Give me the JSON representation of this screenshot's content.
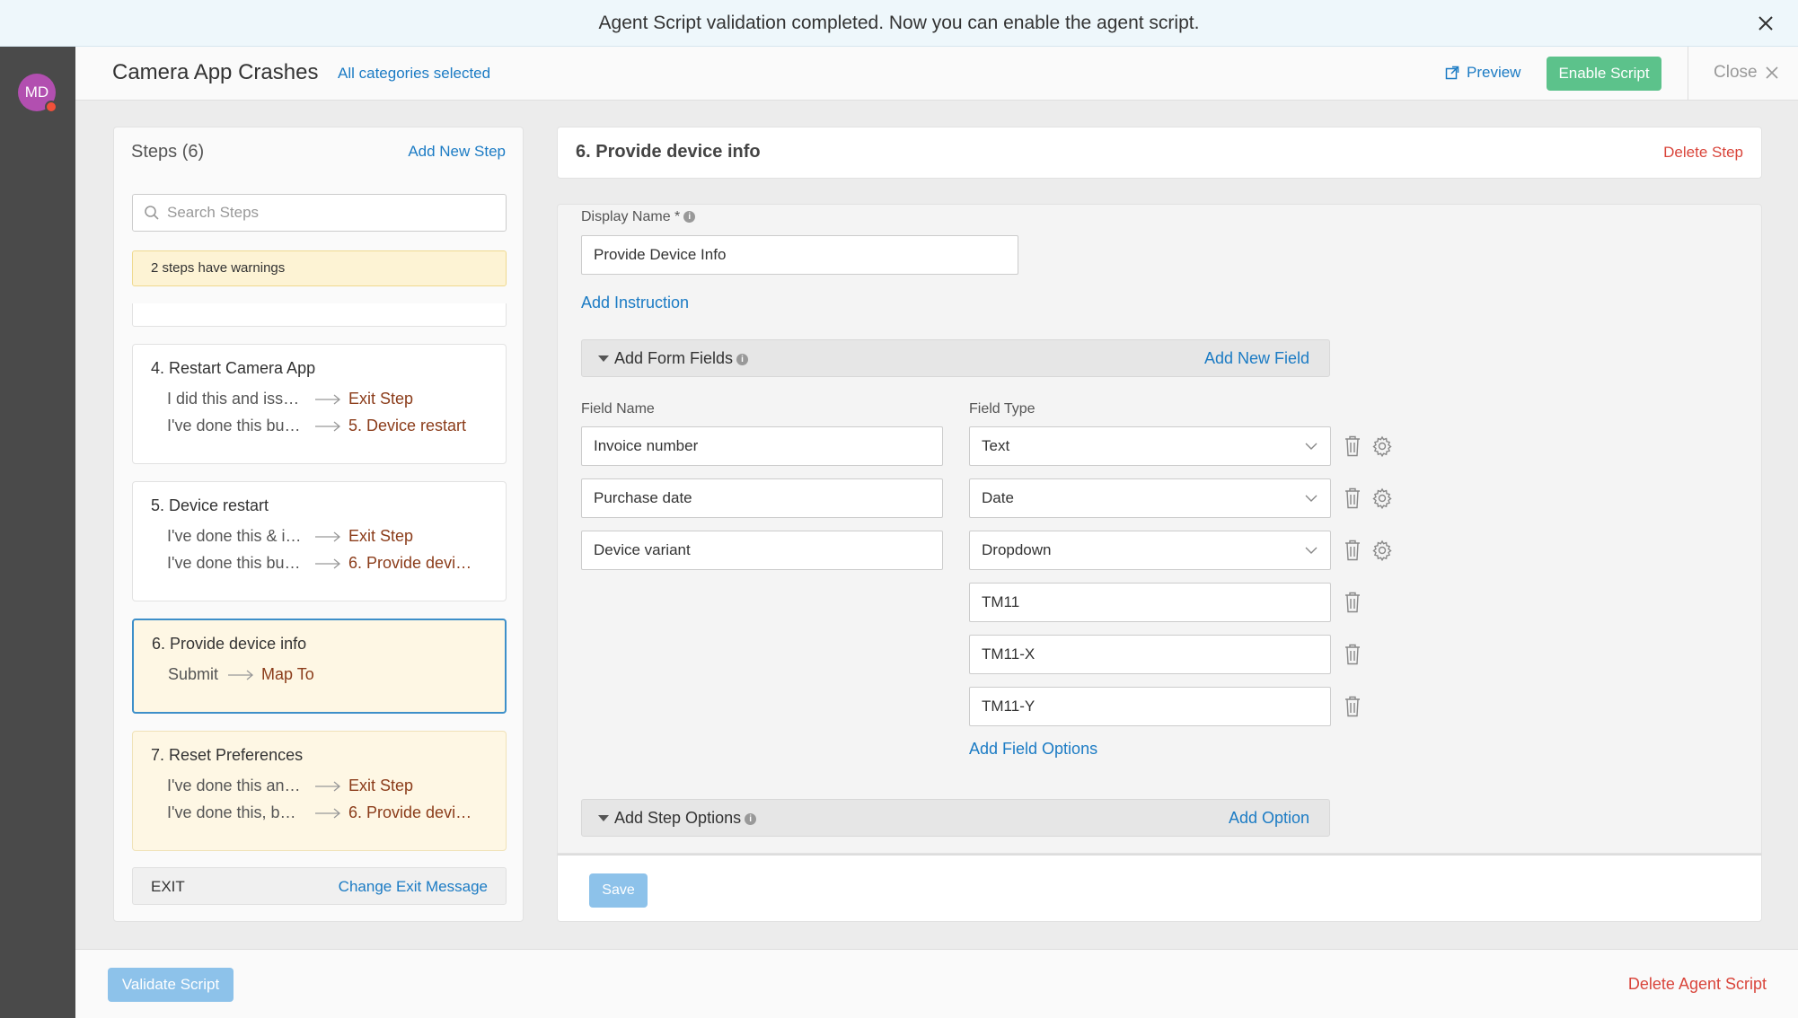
{
  "banner": {
    "message": "Agent Script validation completed. Now you can enable the agent script."
  },
  "user": {
    "initials": "MD"
  },
  "header": {
    "title": "Camera App Crashes",
    "categories": "All categories selected",
    "preview_label": "Preview",
    "enable_label": "Enable Script",
    "close_label": "Close"
  },
  "steps": {
    "title": "Steps (6)",
    "add_label": "Add New Step",
    "search_placeholder": "Search Steps",
    "warning": "2 steps have warnings",
    "cards": [
      {
        "title": "4. Restart Camera App",
        "rows": [
          {
            "label": "I did this and iss…",
            "target": "Exit Step"
          },
          {
            "label": "I've done this bu…",
            "target": "5. Device restart"
          }
        ]
      },
      {
        "title": "5. Device restart",
        "rows": [
          {
            "label": "I've done this & i…",
            "target": "Exit Step"
          },
          {
            "label": "I've done this bu…",
            "target": "6. Provide devi…"
          }
        ]
      },
      {
        "title": "6. Provide device info",
        "rows": [
          {
            "label": "Submit",
            "target": "Map To"
          }
        ]
      },
      {
        "title": "7. Reset Preferences",
        "rows": [
          {
            "label": "I've done this an…",
            "target": "Exit Step"
          },
          {
            "label": "I've done this, b…",
            "target": "6. Provide devi…"
          }
        ]
      }
    ],
    "exit_label": "EXIT",
    "exit_change": "Change Exit Message"
  },
  "detail": {
    "title": "6. Provide device info",
    "delete_label": "Delete Step",
    "display_name_label": "Display Name *",
    "display_name_value": "Provide Device Info",
    "add_instruction": "Add Instruction",
    "form_fields_title": "Add Form Fields",
    "add_field": "Add New Field",
    "field_name_header": "Field Name",
    "field_type_header": "Field Type",
    "fields": [
      {
        "name": "Invoice number",
        "type": "Text"
      },
      {
        "name": "Purchase date",
        "type": "Date"
      },
      {
        "name": "Device variant",
        "type": "Dropdown"
      }
    ],
    "options": [
      "TM11",
      "TM11-X",
      "TM11-Y"
    ],
    "add_field_options": "Add Field Options",
    "step_options_title": "Add Step Options",
    "add_option": "Add Option",
    "save_label": "Save"
  },
  "footer": {
    "validate_label": "Validate Script",
    "delete_script_label": "Delete Agent Script"
  },
  "colors": {
    "link": "#1b7bc4",
    "enable": "#5cc28b",
    "danger": "#d9453b",
    "active_border": "#3d8fc9",
    "warning_bg": "#fdf3d4"
  }
}
